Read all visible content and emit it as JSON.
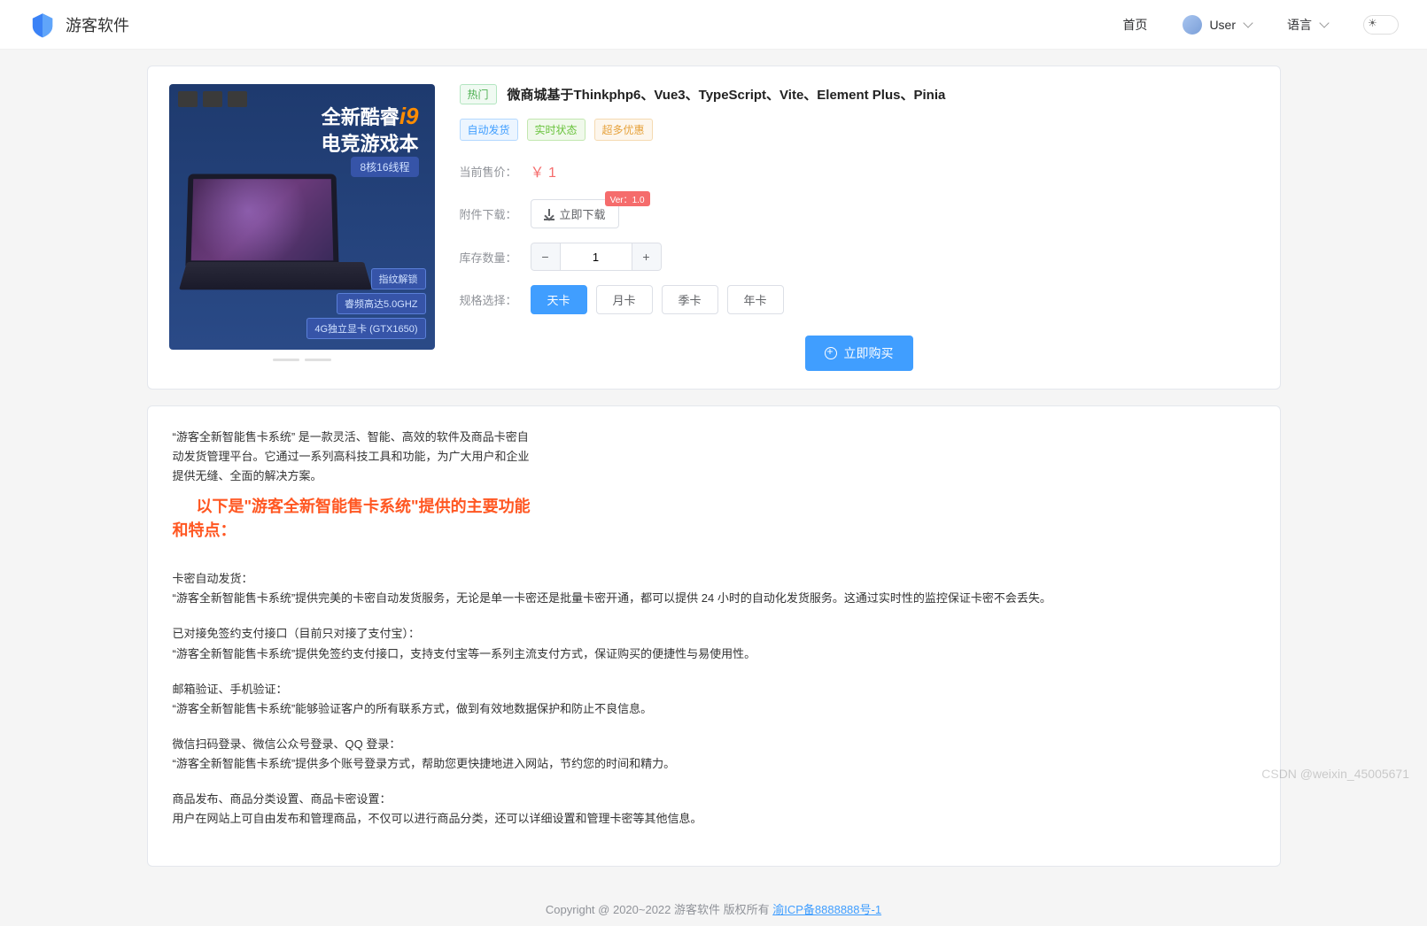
{
  "header": {
    "brand": "游客软件",
    "nav_home": "首页",
    "user_label": "User",
    "lang_label": "语言"
  },
  "product": {
    "image": {
      "title_line1_pre": "全新酷睿",
      "title_line1_accent": "i9",
      "title_line2": "电竞游戏本",
      "chip": "8核16线程",
      "specs": [
        "指纹解锁",
        "睿频高达5.0GHZ",
        "4G独立显卡 (GTX1650)"
      ]
    },
    "hot_tag": "热门",
    "title": "微商城基于Thinkphp6、Vue3、TypeScript、Vite、Element Plus、Pinia",
    "tags": [
      "自动发货",
      "实时状态",
      "超多优惠"
    ],
    "price_label": "当前售价：",
    "price_value": "￥ 1",
    "download_label": "附件下载：",
    "download_btn": "立即下载",
    "ver_badge": "Ver：1.0",
    "stock_label": "库存数量：",
    "stock_qty": "1",
    "spec_label": "规格选择：",
    "specs": [
      "天卡",
      "月卡",
      "季卡",
      "年卡"
    ],
    "buy_btn": "立即购买"
  },
  "description": {
    "intro": "“游客全新智能售卡系统” 是一款灵活、智能、高效的软件及商品卡密自动发货管理平台。它通过一系列高科技工具和功能，为广大用户和企业提供无缝、全面的解决方案。",
    "heading": "以下是\"游客全新智能售卡系统\"提供的主要功能和特点：",
    "blocks": [
      {
        "title": "卡密自动发货：",
        "body": "“游客全新智能售卡系统”提供完美的卡密自动发货服务，无论是单一卡密还是批量卡密开通，都可以提供 24 小时的自动化发货服务。这通过实时性的监控保证卡密不会丢失。"
      },
      {
        "title": "已对接免签约支付接口（目前只对接了支付宝）：",
        "body": "“游客全新智能售卡系统”提供免签约支付接口，支持支付宝等一系列主流支付方式，保证购买的便捷性与易使用性。"
      },
      {
        "title": "邮箱验证、手机验证：",
        "body": "“游客全新智能售卡系统”能够验证客户的所有联系方式，做到有效地数据保护和防止不良信息。"
      },
      {
        "title": "微信扫码登录、微信公众号登录、QQ 登录：",
        "body": "“游客全新智能售卡系统”提供多个账号登录方式，帮助您更快捷地进入网站，节约您的时间和精力。"
      },
      {
        "title": "商品发布、商品分类设置、商品卡密设置：",
        "body": "用户在网站上可自由发布和管理商品，不仅可以进行商品分类，还可以详细设置和管理卡密等其他信息。"
      }
    ]
  },
  "footer": {
    "text_pre": "Copyright @ 2020~2022 游客软件 版权所有 ",
    "icp": "渝ICP备8888888号-1"
  },
  "watermark": "CSDN @weixin_45005671"
}
